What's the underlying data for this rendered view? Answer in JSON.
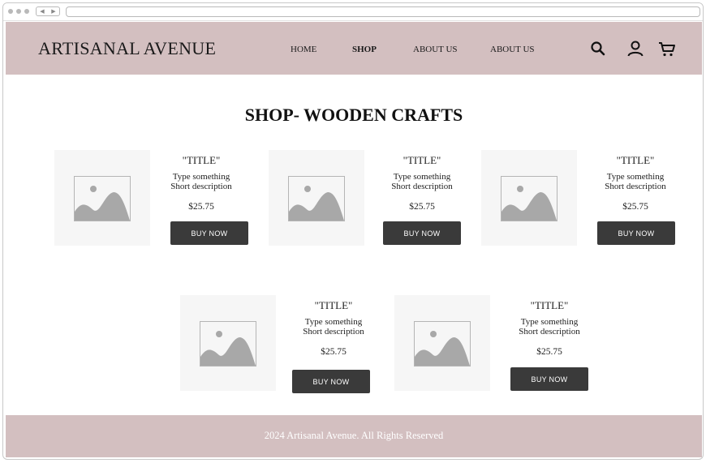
{
  "brand": "ARTISANAL AVENUE",
  "nav": [
    "HOME",
    "SHOP",
    "ABOUT US",
    "ABOUT US"
  ],
  "icons": [
    "search-icon",
    "user-icon",
    "cart-icon"
  ],
  "page_title": "SHOP- WOODEN CRAFTS",
  "products": [
    {
      "title": "\"TITLE\"",
      "desc_line1": "Type something",
      "desc_line2": "Short description",
      "price": "$25.75",
      "button": "BUY NOW"
    },
    {
      "title": "\"TITLE\"",
      "desc_line1": "Type something",
      "desc_line2": "Short description",
      "price": "$25.75",
      "button": "BUY NOW"
    },
    {
      "title": "\"TITLE\"",
      "desc_line1": "Type something",
      "desc_line2": "Short description",
      "price": "$25.75",
      "button": "BUY NOW"
    },
    {
      "title": "\"TITLE\"",
      "desc_line1": "Type something",
      "desc_line2": "Short description",
      "price": "$25.75",
      "button": "BUY NOW"
    },
    {
      "title": "\"TITLE\"",
      "desc_line1": "Type something",
      "desc_line2": "Short description",
      "price": "$25.75",
      "button": "BUY NOW"
    }
  ],
  "footer": "2024 Artisanal Avenue. All Rights Reserved",
  "colors": {
    "header_bg": "#d3bfc0",
    "button_bg": "#3a3a3a",
    "thumb_bg": "#f6f6f6"
  }
}
